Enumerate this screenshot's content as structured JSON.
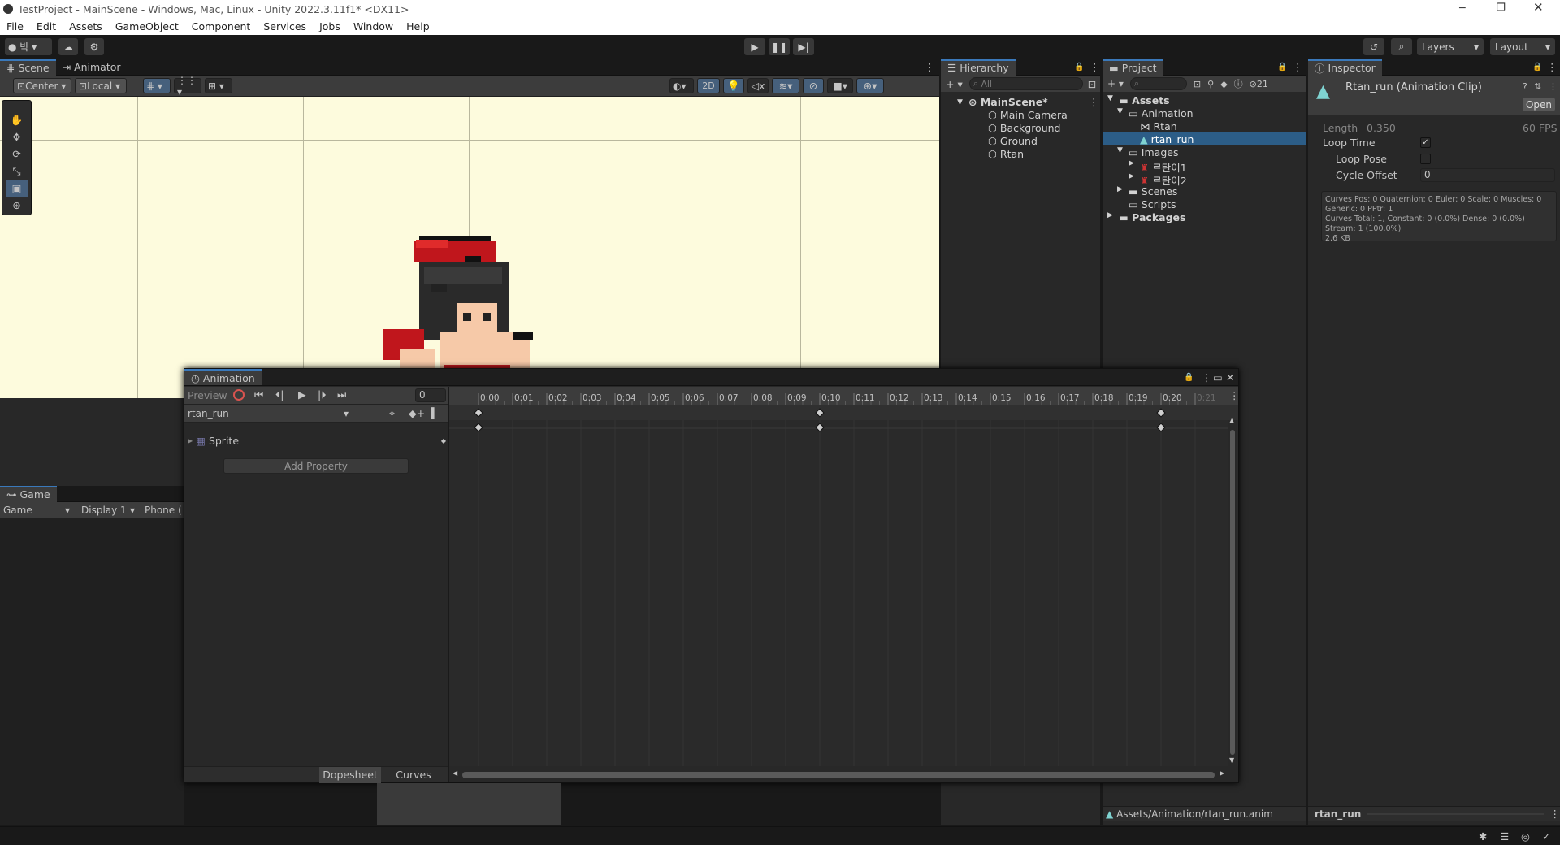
{
  "window": {
    "title": "TestProject - MainScene - Windows, Mac, Linux - Unity 2022.3.11f1* <DX11>"
  },
  "menu": [
    "File",
    "Edit",
    "Assets",
    "GameObject",
    "Component",
    "Services",
    "Jobs",
    "Window",
    "Help"
  ],
  "toolbar": {
    "account": "박",
    "layers": "Layers",
    "layout": "Layout"
  },
  "scene": {
    "tabs": {
      "scene": "Scene",
      "animator": "Animator"
    },
    "pivot": "Center",
    "space": "Local",
    "mode2d": "2D"
  },
  "game": {
    "tab": "Game",
    "view": "Game",
    "display": "Display 1",
    "resolution": "Phone ("
  },
  "hierarchy": {
    "tab": "Hierarchy",
    "search_placeholder": "All",
    "scene": "MainScene*",
    "items": [
      "Main Camera",
      "Background",
      "Ground",
      "Rtan"
    ]
  },
  "project": {
    "tab": "Project",
    "hidden_count": "21",
    "tree": {
      "assets": "Assets",
      "animation": "Animation",
      "rtan": "Rtan",
      "rtan_run": "rtan_run",
      "images": "Images",
      "img1": "르탄이1",
      "img2": "르탄이2",
      "scenes": "Scenes",
      "scripts": "Scripts",
      "packages": "Packages"
    },
    "footer_path": "Assets/Animation/rtan_run.anim"
  },
  "inspector": {
    "tab": "Inspector",
    "title": "Rtan_run (Animation Clip)",
    "open": "Open",
    "length_label": "Length",
    "length_value": "0.350",
    "fps": "60 FPS",
    "loop_time": "Loop Time",
    "loop_pose": "Loop Pose",
    "cycle_offset": "Cycle Offset",
    "cycle_value": "0",
    "info": [
      "Curves Pos: 0 Quaternion: 0 Euler: 0 Scale: 0 Muscles: 0",
      "Generic: 0 PPtr: 1",
      "Curves Total: 1, Constant: 0 (0.0%) Dense: 0 (0.0%)",
      "Stream: 1 (100.0%)",
      "2.6 KB"
    ],
    "footer_name": "rtan_run"
  },
  "animation": {
    "tab": "Animation",
    "preview": "Preview",
    "frame": "0",
    "clip": "rtan_run",
    "property": "Sprite",
    "add_property": "Add Property",
    "dopesheet": "Dopesheet",
    "curves": "Curves",
    "ticks": [
      "0:00",
      "0:01",
      "0:02",
      "0:03",
      "0:04",
      "0:05",
      "0:06",
      "0:07",
      "0:08",
      "0:09",
      "0:10",
      "0:11",
      "0:12",
      "0:13",
      "0:14",
      "0:15",
      "0:16",
      "0:17",
      "0:18",
      "0:19",
      "0:20",
      "0:21"
    ],
    "keyframes": [
      "0:00",
      "0:10",
      "0:20"
    ]
  }
}
